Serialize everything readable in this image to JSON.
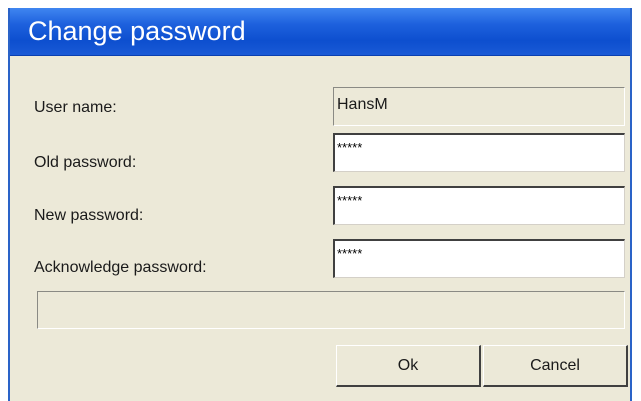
{
  "window": {
    "title": "Change password"
  },
  "form": {
    "user_name_label": "User name:",
    "user_name_value": "HansM",
    "old_password_label": "Old password:",
    "old_password_value": "*****",
    "new_password_label": "New password:",
    "new_password_value": "*****",
    "ack_password_label": "Acknowledge password:",
    "ack_password_value": "*****",
    "status_text": ""
  },
  "buttons": {
    "ok_label": "Ok",
    "cancel_label": "Cancel"
  },
  "colors": {
    "titlebar": "#1d60dd",
    "dialog_bg": "#ece9d8",
    "title_text": "#ffffff"
  }
}
